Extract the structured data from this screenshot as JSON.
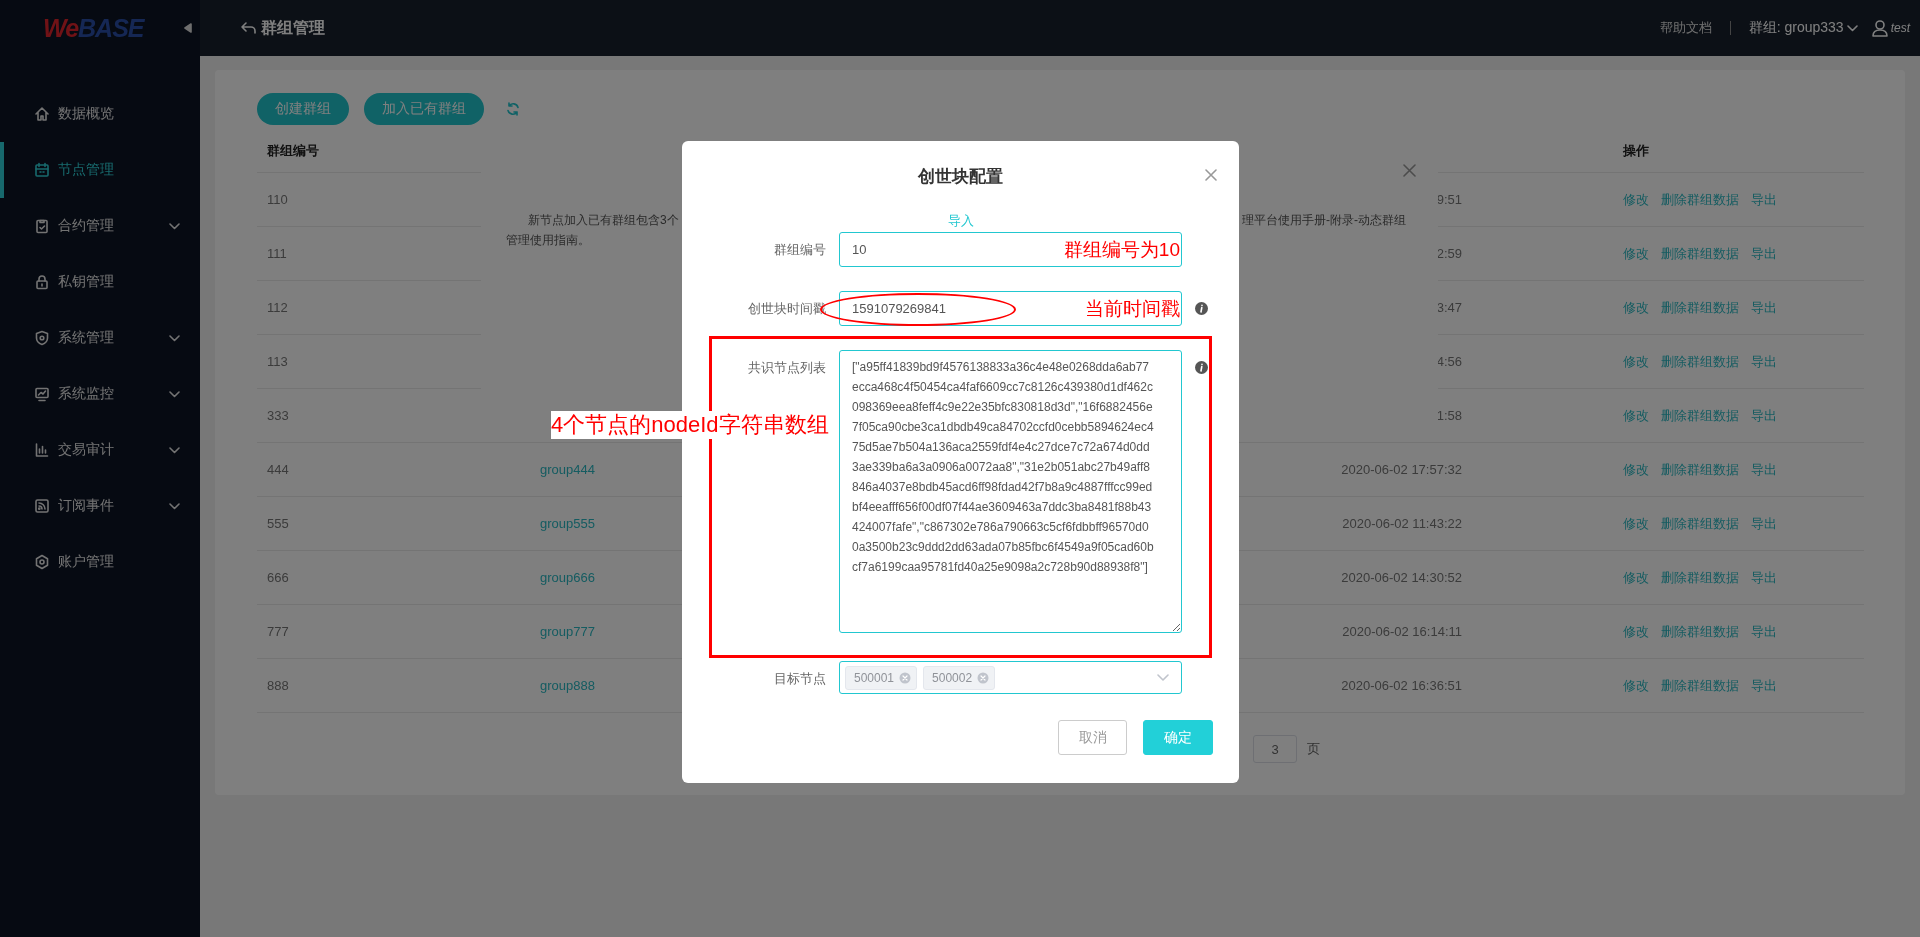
{
  "sidebar": {
    "logo_parts": [
      "We",
      "BASE"
    ],
    "items": [
      {
        "label": "数据概览",
        "selected": false,
        "has_submenu": false
      },
      {
        "label": "节点管理",
        "selected": true,
        "has_submenu": false
      },
      {
        "label": "合约管理",
        "selected": false,
        "has_submenu": true
      },
      {
        "label": "私钥管理",
        "selected": false,
        "has_submenu": false
      },
      {
        "label": "系统管理",
        "selected": false,
        "has_submenu": true
      },
      {
        "label": "系统监控",
        "selected": false,
        "has_submenu": true
      },
      {
        "label": "交易审计",
        "selected": false,
        "has_submenu": true
      },
      {
        "label": "订阅事件",
        "selected": false,
        "has_submenu": true
      },
      {
        "label": "账户管理",
        "selected": false,
        "has_submenu": false
      }
    ]
  },
  "header": {
    "title": "群组管理",
    "help": "帮助文档",
    "group_selector": "群组: group333",
    "user": "test"
  },
  "toolbar": {
    "buttons": [
      "创建群组",
      "加入已有群组"
    ]
  },
  "table": {
    "id_header": "群组编号",
    "actions_header": "操作",
    "rows": [
      {
        "id": "110",
        "time": "9:51",
        "actions": [
          "修改",
          "删除群组数据",
          "导出"
        ]
      },
      {
        "id": "111",
        "time": "2:59",
        "actions": [
          "修改",
          "删除群组数据",
          "导出"
        ]
      },
      {
        "id": "112",
        "time": "3:47",
        "actions": [
          "修改",
          "删除群组数据",
          "导出"
        ]
      },
      {
        "id": "113",
        "time": "4:56",
        "actions": [
          "修改",
          "删除群组数据",
          "导出"
        ]
      },
      {
        "id": "333",
        "time": "1:58",
        "actions": [
          "修改",
          "删除群组数据",
          "导出"
        ]
      },
      {
        "id": "444",
        "name": "group444",
        "time": "2020-06-02 17:57:32",
        "actions": [
          "修改",
          "删除群组数据",
          "导出"
        ]
      },
      {
        "id": "555",
        "name": "group555",
        "time": "2020-06-02 11:43:22",
        "actions": [
          "修改",
          "删除群组数据",
          "导出"
        ]
      },
      {
        "id": "666",
        "name": "group666",
        "time": "2020-06-02 14:30:52",
        "actions": [
          "修改",
          "删除群组数据",
          "导出"
        ]
      },
      {
        "id": "777",
        "name": "group777",
        "time": "2020-06-02 16:14:11",
        "actions": [
          "修改",
          "删除群组数据",
          "导出"
        ]
      },
      {
        "id": "888",
        "name": "group888",
        "time": "2020-06-02 16:36:51",
        "actions": [
          "修改",
          "删除群组数据",
          "导出"
        ]
      }
    ]
  },
  "pagination": {
    "page": "3",
    "suffix": "页"
  },
  "background_dialog": {
    "text_left": "新节点加入已有群组包含3个",
    "text_left_line2": "管理使用指南。",
    "text_right": "理平台使用手册-附录-动态群组"
  },
  "modal": {
    "title": "创世块配置",
    "import_link": "导入",
    "fields": [
      {
        "label": "群组编号",
        "kind": "input",
        "value": "10",
        "info": false,
        "note": "群组编号为10",
        "value_circled": false,
        "boxed": false
      },
      {
        "label": "创世块时间戳",
        "kind": "input",
        "value": "1591079269841",
        "info": true,
        "note": "当前时间戳",
        "value_circled": true,
        "boxed": false
      },
      {
        "label": "共识节点列表",
        "kind": "textarea",
        "value": "[\"a95ff41839bd9f4576138833a36c4e48e0268dda6ab77ecca468c4f50454ca4faf6609cc7c8126c439380d1df462c098369eea8feff4c9e22e35bfc830818d3d\",\"16f6882456e7f05ca90cbe3ca1dbdb49ca84702ccfd0cebb5894624ec475d5ae7b504a136aca2559fdf4e4c27dce7c72a674d0dd3ae339ba6a3a0906a0072aa8\",\"31e2b051abc27b49aff8846a4037e8bdb45acd6ff98fdad42f7b8a9c4887fffcc99edbf4eeafff656f00df07f44ae3609463a7ddc3ba8481f88b43424007fafe\",\"c867302e786a790663c5cf6fdbbff96570d00a3500b23c9ddd2dd63ada07b85fbc6f4549a9f05cad60bcf7a6199caa95781fd40a25e9098a2c728b90d88938f8\"]",
        "info": true,
        "value_circled": false,
        "boxed": true,
        "box_note": "4个节点的nodeId字符串数组"
      },
      {
        "label": "目标节点",
        "kind": "select",
        "tags": [
          "500001",
          "500002"
        ],
        "info": false,
        "value_circled": false,
        "boxed": false
      }
    ],
    "buttons": [
      {
        "label": "取消",
        "kind": "secondary"
      },
      {
        "label": "确定",
        "kind": "primary"
      }
    ]
  }
}
